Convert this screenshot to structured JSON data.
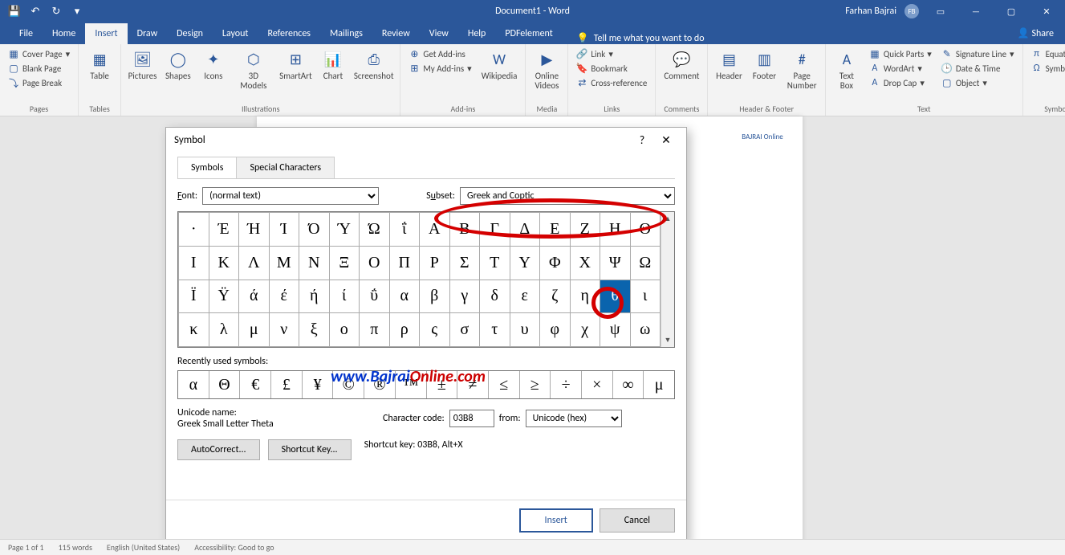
{
  "title_center": "Document1 - Word",
  "user_name": "Farhan Bajrai",
  "user_initials": "FB",
  "ribbon_tabs": [
    "File",
    "Home",
    "Insert",
    "Draw",
    "Design",
    "Layout",
    "References",
    "Mailings",
    "Review",
    "View",
    "Help",
    "PDFelement"
  ],
  "tell_me": "Tell me what you want to do",
  "share": "Share",
  "pages_group": {
    "label": "Pages",
    "cover": "Cover Page",
    "blank": "Blank Page",
    "break": "Page Break"
  },
  "tables_group": {
    "label": "Tables",
    "table": "Table"
  },
  "illus_group": {
    "label": "Illustrations",
    "pictures": "Pictures",
    "shapes": "Shapes",
    "icons": "Icons",
    "models": "3D\nModels",
    "smartart": "SmartArt",
    "chart": "Chart",
    "screenshot": "Screenshot"
  },
  "addins_group": {
    "label": "Add-ins",
    "get": "Get Add-ins",
    "my": "My Add-ins",
    "wiki": "Wikipedia"
  },
  "media_group": {
    "label": "Media",
    "video": "Online\nVideos"
  },
  "links_group": {
    "label": "Links",
    "link": "Link",
    "bookmark": "Bookmark",
    "cross": "Cross-reference"
  },
  "comments_group": {
    "label": "Comments",
    "comment": "Comment"
  },
  "hf_group": {
    "label": "Header & Footer",
    "header": "Header",
    "footer": "Footer",
    "pagenum": "Page\nNumber"
  },
  "text_group": {
    "label": "Text",
    "textbox": "Text\nBox",
    "quick": "Quick Parts",
    "wordart": "WordArt",
    "dropcap": "Drop Cap",
    "sig": "Signature Line",
    "date": "Date & Time",
    "object": "Object"
  },
  "sym_group": {
    "label": "Symbols",
    "eq": "Equation",
    "sym": "Symbol"
  },
  "dialog": {
    "title": "Symbol",
    "tab_symbols": "Symbols",
    "tab_special": "Special Characters",
    "font_label": "Font:",
    "font_value": "(normal text)",
    "subset_label": "Subset:",
    "subset_value": "Greek and Coptic",
    "grid": [
      [
        "·",
        "Έ",
        "Ή",
        "Ί",
        "Ό",
        "Ύ",
        "Ώ",
        "ΐ",
        "Α",
        "Β",
        "Γ",
        "Δ",
        "Ε",
        "Ζ",
        "Η",
        "Θ"
      ],
      [
        "Ι",
        "Κ",
        "Λ",
        "Μ",
        "Ν",
        "Ξ",
        "Ο",
        "Π",
        "Ρ",
        "Σ",
        "Τ",
        "Υ",
        "Φ",
        "Χ",
        "Ψ",
        "Ω"
      ],
      [
        "Ϊ",
        "Ϋ",
        "ά",
        "έ",
        "ή",
        "ί",
        "ΰ",
        "α",
        "β",
        "γ",
        "δ",
        "ε",
        "ζ",
        "η",
        "θ",
        "ι"
      ],
      [
        "κ",
        "λ",
        "μ",
        "ν",
        "ξ",
        "ο",
        "π",
        "ρ",
        "ς",
        "σ",
        "τ",
        "υ",
        "φ",
        "χ",
        "ψ",
        "ω"
      ]
    ],
    "selected_row": 2,
    "selected_col": 14,
    "recent_label": "Recently used symbols:",
    "recent": [
      "α",
      "Θ",
      "€",
      "£",
      "¥",
      "©",
      "®",
      "™",
      "±",
      "≠",
      "≤",
      "≥",
      "÷",
      "×",
      "∞",
      "μ"
    ],
    "uname_label": "Unicode name:",
    "uname_value": "Greek Small Letter Theta",
    "code_label": "Character code:",
    "code_value": "03B8",
    "from_label": "from:",
    "from_value": "Unicode (hex)",
    "autocorrect": "AutoCorrect...",
    "shortcut_btn": "Shortcut Key...",
    "shortcut_txt": "Shortcut key: 03B8, Alt+X",
    "insert": "Insert",
    "cancel": "Cancel"
  },
  "watermark": {
    "p1": "www.Bajrai",
    "p2": "Online.com"
  },
  "statusbar": {
    "page": "Page 1 of 1",
    "words": "115 words",
    "lang": "English (United States)",
    "access": "Accessibility: Good to go"
  },
  "doc_logo": "BAJRAI Online"
}
